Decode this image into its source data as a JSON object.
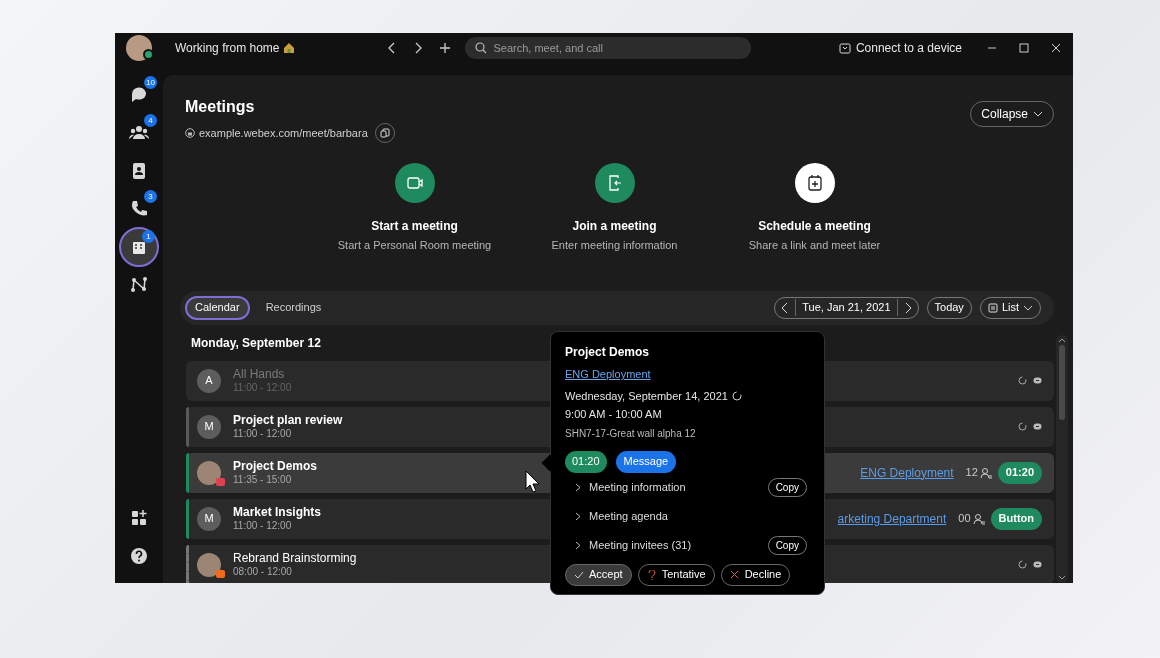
{
  "title_bar": {
    "status": "Working from home",
    "search_placeholder": "Search, meet, and call",
    "connect": "Connect to a device"
  },
  "sidebar": {
    "items": [
      {
        "kind": "chat",
        "badge": "10",
        "selected": false
      },
      {
        "kind": "teams",
        "badge": "4",
        "selected": false
      },
      {
        "kind": "contacts",
        "selected": false
      },
      {
        "kind": "calls",
        "badge": "3",
        "selected": false
      },
      {
        "kind": "meetings",
        "badge": "1",
        "selected": true
      },
      {
        "kind": "connector",
        "selected": false
      }
    ],
    "bottom": [
      {
        "kind": "apps"
      },
      {
        "kind": "help"
      }
    ]
  },
  "header": {
    "title": "Meetings",
    "link": "example.webex.com/meet/barbara",
    "collapse": "Collapse"
  },
  "actions": [
    {
      "kind": "start",
      "title": "Start a meeting",
      "subtitle": "Start a Personal Room meeting"
    },
    {
      "kind": "join",
      "title": "Join a meeting",
      "subtitle": "Enter meeting information"
    },
    {
      "kind": "schedule",
      "title": "Schedule a meeting",
      "subtitle": "Share a link and meet later"
    }
  ],
  "tabs": [
    {
      "label": "Calendar",
      "selected": true
    },
    {
      "label": "Recordings",
      "selected": false
    }
  ],
  "date_nav": {
    "date": "Tue, Jan 21, 2021",
    "today": "Today",
    "view": "List"
  },
  "day_heading": "Monday, September 12",
  "meetings": [
    {
      "kind": "icons",
      "title": "All Hands",
      "time": "11:00 - 12:00",
      "avatar": {
        "kind": "letter",
        "letter": "A"
      },
      "dimmed": true,
      "bold": false,
      "selected": false
    },
    {
      "kind": "icons",
      "title": "Project plan review",
      "time": "11:00 - 12:00",
      "avatar": {
        "kind": "letter",
        "letter": "M"
      },
      "accent": {
        "kind": "solid",
        "color": "#5a5a5a"
      },
      "dimmed": false,
      "bold": true,
      "selected": false
    },
    {
      "kind": "join",
      "title": "Project Demos",
      "time": "11:35 - 15:00",
      "avatar": {
        "kind": "photo",
        "color": "#e0404f"
      },
      "accent": {
        "kind": "solid",
        "color": "#1e8a5e"
      },
      "dimmed": false,
      "bold": true,
      "selected": true,
      "link": "ENG Deployment",
      "count": "12",
      "button": "01:20"
    },
    {
      "kind": "join",
      "title": "Market Insights",
      "time": "11:00 - 12:00",
      "avatar": {
        "kind": "letter",
        "letter": "M"
      },
      "accent": {
        "kind": "solid",
        "color": "#1e8a5e"
      },
      "dimmed": false,
      "bold": true,
      "selected": false,
      "link": "arketing Department",
      "count": "00",
      "button": "Button"
    },
    {
      "kind": "icons",
      "title": "Rebrand Brainstorming",
      "time": "08:00 - 12:00",
      "avatar": {
        "kind": "photo",
        "color": "#f26b1d"
      },
      "accent": {
        "kind": "dashed",
        "color": "#777777"
      },
      "dimmed": false,
      "bold": false,
      "selected": false
    }
  ],
  "popover": {
    "title": "Project Demos",
    "link": "ENG Deployment",
    "date": "Wednesday, September 14, 2021",
    "time": "9:00 AM - 10:00 AM",
    "location": "SHN7-17-Great wall alpha 12",
    "timer": "01:20",
    "message": "Message",
    "sections": [
      {
        "label": "Meeting information",
        "copy": "Copy"
      },
      {
        "label": "Meeting agenda"
      },
      {
        "label": "Meeting invitees (31)",
        "copy": "Copy"
      }
    ],
    "responses": [
      {
        "kind": "accept",
        "label": "Accept",
        "selected": true
      },
      {
        "kind": "tentative",
        "label": "Tentative",
        "selected": false
      },
      {
        "kind": "decline",
        "label": "Decline",
        "selected": false
      }
    ]
  }
}
